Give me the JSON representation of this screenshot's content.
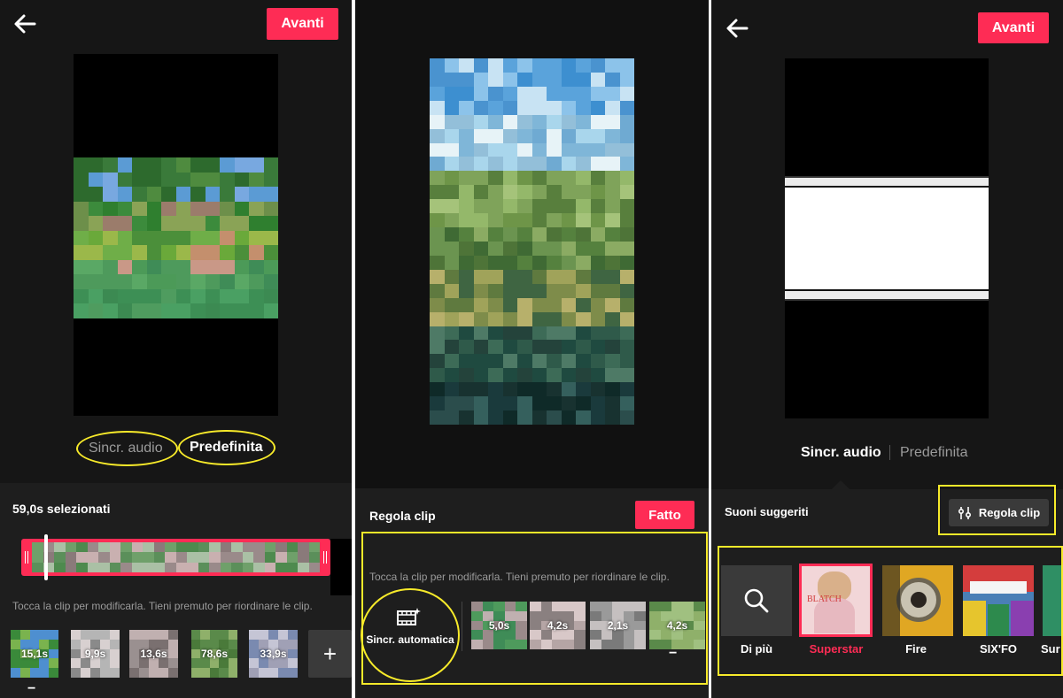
{
  "panel1": {
    "next_button": "Avanti",
    "tab_sync": "Sincr. audio",
    "tab_default": "Predefinita",
    "selected_duration": "59,0s selezionati",
    "hint": "Tocca la clip per modificarla. Tieni premuto per riordinare le clip.",
    "clips": [
      {
        "duration": "15,1s"
      },
      {
        "duration": "9,9s"
      },
      {
        "duration": "13,6s"
      },
      {
        "duration": "78,6s"
      },
      {
        "duration": "33,9s"
      }
    ],
    "add_label": "+",
    "minus_label": "−"
  },
  "panel2": {
    "title": "Regola clip",
    "done_button": "Fatto",
    "hint": "Tocca la clip per modificarla. Tieni premuto per riordinare le clip.",
    "auto_sync": "Sincr. automatica",
    "clips": [
      {
        "duration": "5,0s"
      },
      {
        "duration": "4,2s"
      },
      {
        "duration": "2,1s"
      },
      {
        "duration": "4,2s"
      }
    ],
    "minus_label": "−"
  },
  "panel3": {
    "next_button": "Avanti",
    "tab_sync": "Sincr. audio",
    "tab_default": "Predefinita",
    "suggested_title": "Suoni suggeriti",
    "adjust_button": "Regola clip",
    "sounds": [
      {
        "label": "Di più",
        "icon": "search-icon",
        "active": false
      },
      {
        "label": "Superstar",
        "icon": "cover-portrait",
        "active": true
      },
      {
        "label": "Fire",
        "icon": "cover-yellow",
        "active": false
      },
      {
        "label": "SIX'FO",
        "icon": "cover-colorful",
        "active": false
      },
      {
        "label": "Sur",
        "icon": "cover-green",
        "active": false
      }
    ]
  },
  "colors": {
    "accent": "#fe2c55",
    "highlight": "#f7ea2a",
    "background": "#161616",
    "sheet": "#1e1e1e"
  }
}
